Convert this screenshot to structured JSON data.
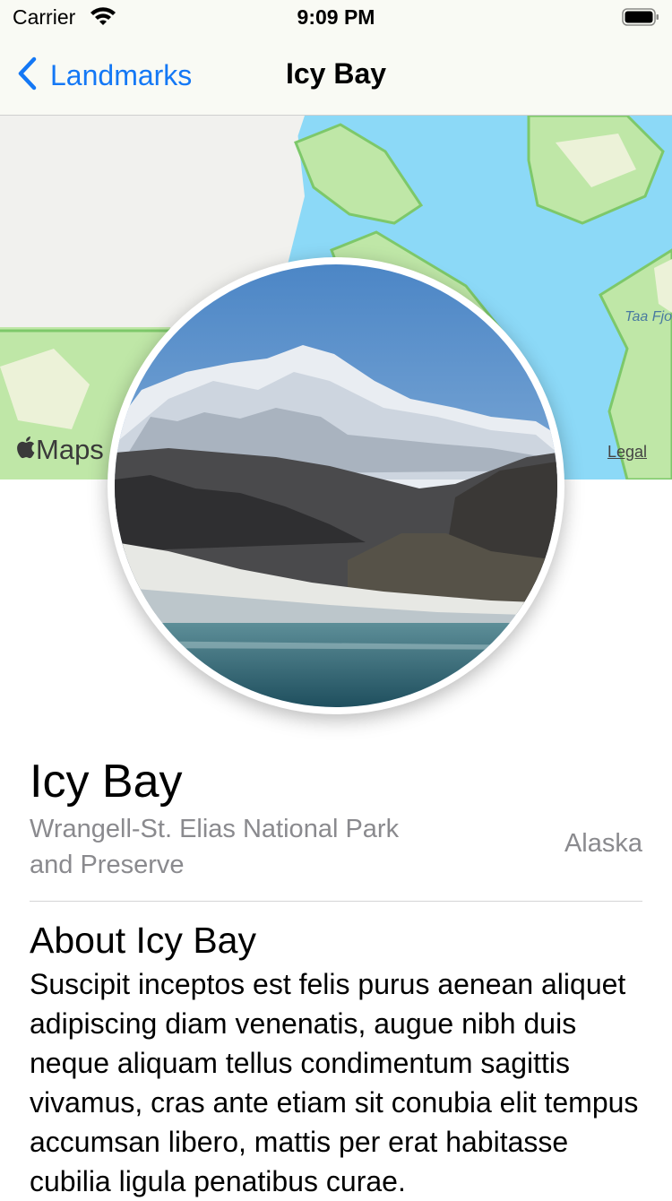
{
  "status_bar": {
    "carrier": "Carrier",
    "time": "9:09 PM"
  },
  "nav": {
    "back_label": "Landmarks",
    "title": "Icy Bay"
  },
  "map": {
    "attribution": "Maps",
    "legal": "Legal",
    "label_partial": "Taa Fjo"
  },
  "landmark": {
    "name": "Icy Bay",
    "park": "Wrangell-St. Elias National Park and Preserve",
    "state": "Alaska",
    "about_heading": "About Icy Bay",
    "description": "Suscipit inceptos est felis purus aenean aliquet adipiscing diam venenatis, augue nibh duis neque aliquam tellus condimentum sagittis vivamus, cras ante etiam sit conubia elit tempus accumsan libero, mattis per erat habitasse cubilia ligula penatibus curae."
  },
  "colors": {
    "accent": "#1478f5",
    "secondary_text": "#8a8a8e",
    "water": "#8cd9f7",
    "land": "#bfe7a7"
  }
}
